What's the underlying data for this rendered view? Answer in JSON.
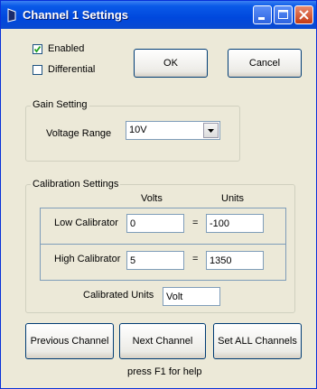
{
  "window": {
    "title": "Channel 1 Settings"
  },
  "options": {
    "enabled_label": "Enabled",
    "enabled_checked": true,
    "differential_label": "Differential",
    "differential_checked": false
  },
  "buttons": {
    "ok": "OK",
    "cancel": "Cancel",
    "previous": "Previous Channel",
    "next": "Next Channel",
    "set_all": "Set ALL Channels"
  },
  "gain": {
    "group_label": "Gain Setting",
    "voltage_range_label": "Voltage Range",
    "voltage_range_value": "10V"
  },
  "calibration": {
    "group_label": "Calibration Settings",
    "volts_header": "Volts",
    "units_header": "Units",
    "low": {
      "label": "Low Calibrator",
      "volts": "0",
      "equals": "=",
      "units": "-100"
    },
    "high": {
      "label": "High Calibrator",
      "volts": "5",
      "equals": "=",
      "units": "1350"
    },
    "calibrated_units_label": "Calibrated Units",
    "calibrated_units_value": "Volt"
  },
  "help_text": "press F1 for help"
}
